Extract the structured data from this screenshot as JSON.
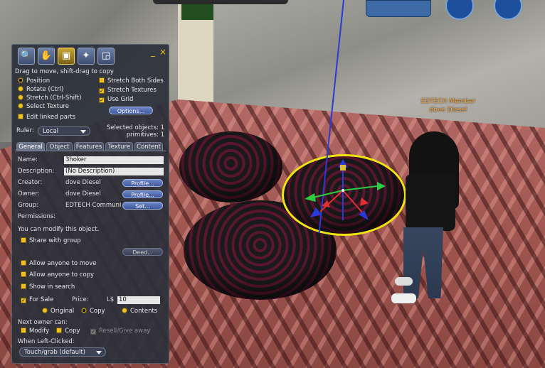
{
  "scene": {
    "name_tag": [
      "EDTECH Member",
      "dove Diesel"
    ]
  },
  "toolbar": {
    "tools": [
      "focus-tool",
      "move-tool",
      "edit-tool",
      "create-tool",
      "land-tool"
    ],
    "selected_tool": "edit-tool",
    "minimize": "_",
    "close": "×"
  },
  "hint": "Drag to move, shift-drag to copy",
  "modes": [
    {
      "label": "Position",
      "checked": true
    },
    {
      "label": "Rotate (Ctrl)",
      "checked": false
    },
    {
      "label": "Stretch (Ctrl-Shift)",
      "checked": false
    },
    {
      "label": "Select Texture",
      "checked": false
    }
  ],
  "edit_linked": "Edit linked parts",
  "stretch_options": [
    {
      "label": "Stretch Both Sides",
      "checked": false
    },
    {
      "label": "Stretch Textures",
      "checked": true
    },
    {
      "label": "Use Grid",
      "checked": true
    }
  ],
  "options_button": "Options...",
  "ruler": {
    "label": "Ruler:",
    "value": "Local"
  },
  "selection": {
    "objects": "Selected objects: 1",
    "primitives": "primitives: 1"
  },
  "tabs": [
    {
      "label": "General",
      "selected": true
    },
    {
      "label": "Object",
      "selected": false
    },
    {
      "label": "Features",
      "selected": false
    },
    {
      "label": "Texture",
      "selected": false
    },
    {
      "label": "Content",
      "selected": false
    }
  ],
  "general": {
    "name_label": "Name:",
    "name_value": "3hoker",
    "description_label": "Description:",
    "description_value": "(No Description)",
    "creator_label": "Creator:",
    "creator_value": "dove Diesel",
    "owner_label": "Owner:",
    "owner_value": "dove Diesel",
    "group_label": "Group:",
    "group_value": "EDTECH Communi",
    "profile_button": "Profile...",
    "set_button": "Set...",
    "permissions": "Permissions:",
    "modify_note": "You can modify this object.",
    "share_group": "Share with group",
    "deed_button": "Deed...",
    "allow_move": "Allow anyone to move",
    "allow_copy": "Allow anyone to copy",
    "show_search": "Show in search",
    "for_sale": "For Sale",
    "price_label": "Price:",
    "currency": "L$",
    "price_value": "10",
    "sale_types": [
      {
        "label": "Original",
        "checked": false
      },
      {
        "label": "Copy",
        "checked": true
      },
      {
        "label": "Contents",
        "checked": false
      }
    ],
    "next_owner": "Next owner can:",
    "next_modify": "Modify",
    "next_copy": "Copy",
    "next_resell": "Resell/Give away",
    "left_click_label": "When Left-Clicked:",
    "left_click_value": "Touch/grab (default)"
  }
}
